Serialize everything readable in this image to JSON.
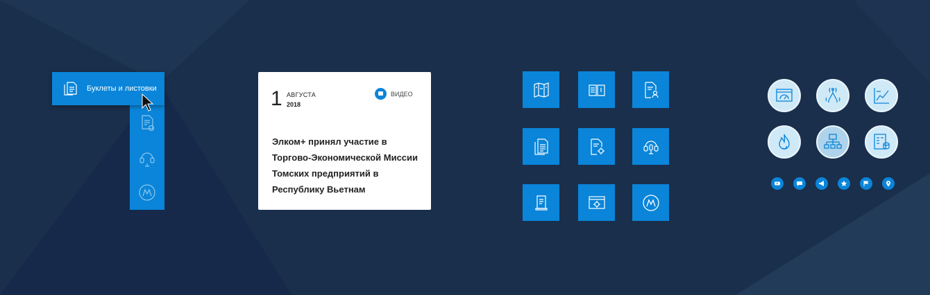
{
  "menu": {
    "popup_label": "Буклеты и листовки",
    "items": [
      {
        "icon": "document-gear-icon"
      },
      {
        "icon": "headset-icon"
      },
      {
        "icon": "logo-m-icon"
      }
    ]
  },
  "news_card": {
    "day": "1",
    "month": "АВГУСТА",
    "year": "2018",
    "video_label": "ВИДЕО",
    "title": "Элком+ принял участие в Торгово-Экономической Миссии Томских предприятий в Республику Вьетнам"
  },
  "tile_grid": [
    "map-icon",
    "book-info-icon",
    "document-user-icon",
    "documents-icon",
    "document-gear-icon",
    "headset-icon",
    "scroll-icon",
    "browser-gear-icon",
    "logo-m-icon"
  ],
  "round_icons": [
    "dashboard-icon",
    "antenna-network-icon",
    "chart-icon",
    "flame-icon",
    "hierarchy-icon",
    "form-database-icon"
  ],
  "small_icons": [
    "youtube-icon",
    "chat-icon",
    "megaphone-icon",
    "star-icon",
    "flag-icon",
    "map-pin-icon"
  ],
  "colors": {
    "background": "#1a2f4b",
    "accent": "#0a85d9",
    "card": "#ffffff",
    "circle_fill": "#cfe9f7"
  }
}
